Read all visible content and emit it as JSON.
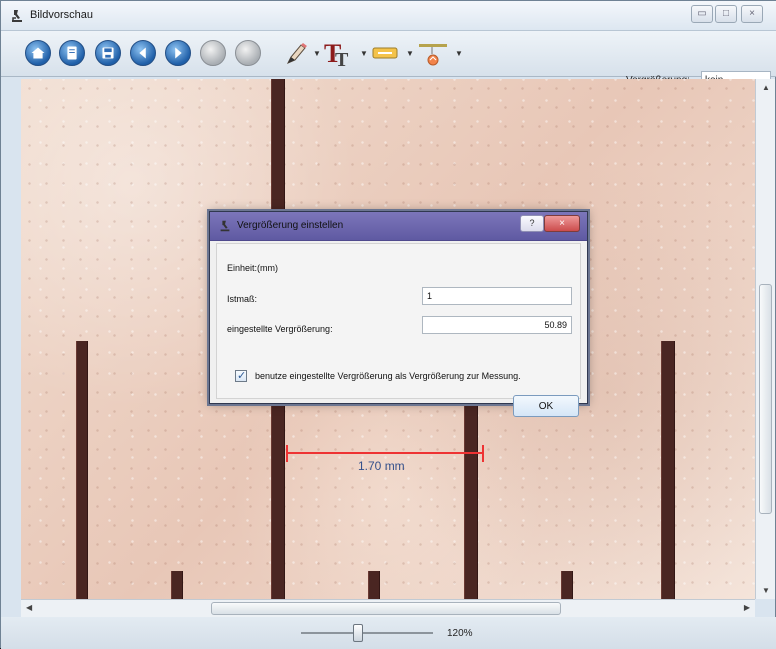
{
  "window": {
    "title": "Bildvorschau",
    "controls": [
      "▭",
      "□",
      "×"
    ]
  },
  "toolbar": {
    "buttons": [
      "",
      "",
      "",
      "",
      "",
      "",
      ""
    ],
    "magnification_label": "Vergrößerung:",
    "magnification_value": "kein"
  },
  "image": {
    "measurement_label": "1.70 mm"
  },
  "status": {
    "zoom_label": "120%",
    "zoom_fraction": 0.45
  },
  "dialog": {
    "title": "Vergrößerung einstellen",
    "help_label": "?",
    "close_label": "×",
    "unit_label": "Einheit:(mm)",
    "actual_label": "Istmaß:",
    "actual_value": "1",
    "set_mag_label": "eingestellte Vergrößerung:",
    "set_mag_value": "50.89",
    "checkbox_label": "benutze eingestellte Vergrößerung als Vergrößerung zur Messung.",
    "checkbox_checked": true,
    "ok_label": "OK"
  },
  "colors": {
    "dialog_title": "#6a64ac",
    "measure_line": "#ee3333",
    "scale_line": "#4a2622"
  },
  "icons": [
    "microscope-icon",
    "home-icon",
    "document-icon",
    "save-icon",
    "prev-icon",
    "next-icon",
    "pencil-icon",
    "text-icon",
    "marker-icon",
    "measure-icon"
  ]
}
